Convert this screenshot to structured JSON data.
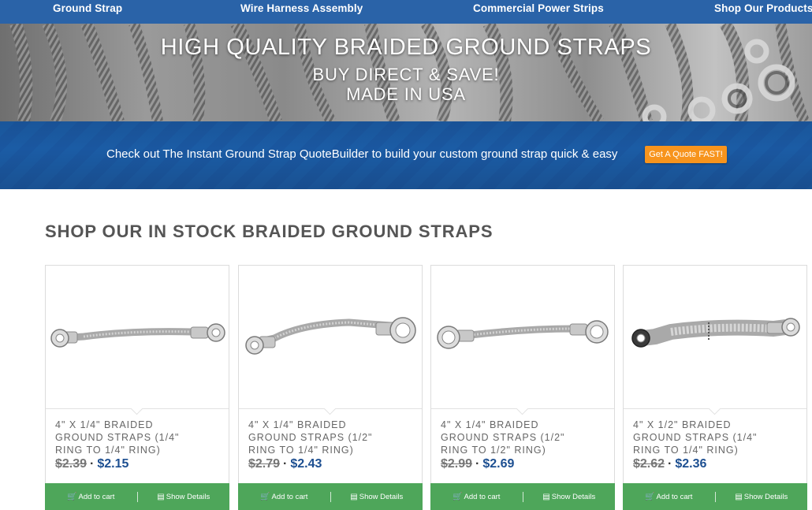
{
  "nav": {
    "items": [
      {
        "label": "Ground Strap"
      },
      {
        "label": "Wire Harness Assembly"
      },
      {
        "label": "Commercial Power Strips"
      },
      {
        "label": "Shop Our Products"
      }
    ]
  },
  "hero": {
    "title": "HIGH QUALITY BRAIDED GROUND STRAPS",
    "subtitle1": "BUY DIRECT & SAVE!",
    "subtitle2": "MADE IN USA"
  },
  "promo": {
    "text": "Check out The Instant Ground Strap QuoteBuilder to build your custom ground strap quick & easy",
    "button_label": "Get A Quote FAST!"
  },
  "section": {
    "title": "SHOP OUR IN STOCK BRAIDED GROUND STRAPS"
  },
  "colors": {
    "nav_bg": "#2a63a8",
    "promo_bg": "#1b5ca5",
    "quote_button": "#f7941d",
    "card_action_bg": "#4ea65a",
    "price_new": "#1d4f91"
  },
  "products": [
    {
      "name": "4\" X 1/4\" BRAIDED GROUND STRAPS (1/4\" RING TO 1/4\" RING)",
      "old_price": "$2.39",
      "sep": "·",
      "price": "$2.15",
      "add_label": "Add to cart",
      "details_label": "Show Details",
      "add_icon": "cart-icon",
      "details_icon": "document-icon"
    },
    {
      "name": "4\" X 1/4\" BRAIDED GROUND STRAPS (1/2\" RING TO 1/4\" RING)",
      "old_price": "$2.79",
      "sep": "·",
      "price": "$2.43",
      "add_label": "Add to cart",
      "details_label": "Show Details",
      "add_icon": "cart-icon",
      "details_icon": "document-icon"
    },
    {
      "name": "4\" X 1/4\" BRAIDED GROUND STRAPS (1/2\" RING TO 1/2\" RING)",
      "old_price": "$2.99",
      "sep": "·",
      "price": "$2.69",
      "add_label": "Add to cart",
      "details_label": "Show Details",
      "add_icon": "cart-icon",
      "details_icon": "document-icon"
    },
    {
      "name": "4\" X 1/2\" BRAIDED GROUND STRAPS (1/4\" RING TO 1/4\" RING)",
      "old_price": "$2.62",
      "sep": "·",
      "price": "$2.36",
      "add_label": "Add to cart",
      "details_label": "Show Details",
      "add_icon": "cart-icon",
      "details_icon": "document-icon"
    }
  ]
}
